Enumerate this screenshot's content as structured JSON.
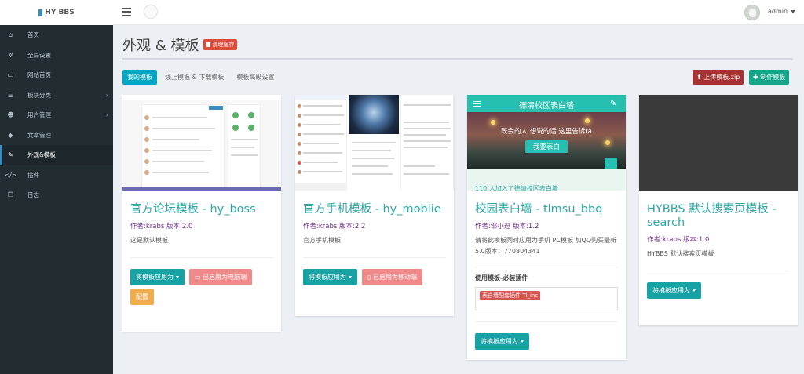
{
  "brand": {
    "name": "HY BBS"
  },
  "header": {
    "user_name": "admin"
  },
  "sidebar": {
    "items": [
      {
        "label": "首页",
        "icon": "home-icon",
        "glyph": "⌂",
        "has_children": false
      },
      {
        "label": "全局设置",
        "icon": "gear-icon",
        "glyph": "✲",
        "has_children": false
      },
      {
        "label": "网站首页",
        "icon": "monitor-icon",
        "glyph": "▭",
        "has_children": false
      },
      {
        "label": "板块分类",
        "icon": "list-icon",
        "glyph": "☰",
        "has_children": true
      },
      {
        "label": "用户管理",
        "icon": "users-icon",
        "glyph": "☻",
        "has_children": true
      },
      {
        "label": "文章管理",
        "icon": "tag-icon",
        "glyph": "◆",
        "has_children": false
      },
      {
        "label": "外观&模板",
        "icon": "brush-icon",
        "glyph": "✎",
        "has_children": false,
        "active": true
      },
      {
        "label": "插件",
        "icon": "code-icon",
        "glyph": "</>",
        "has_children": false
      },
      {
        "label": "日志",
        "icon": "cube-icon",
        "glyph": "❒",
        "has_children": false
      }
    ]
  },
  "page": {
    "title": "外观 & 模板",
    "clear_cache_label": "清理缓存"
  },
  "tabs": [
    {
      "label": "我的模板",
      "active": true
    },
    {
      "label": "线上模板 & 下载模板",
      "active": false
    },
    {
      "label": "模板高级设置",
      "active": false
    }
  ],
  "actions": {
    "upload_label": "上传模板.zip",
    "make_label": "制作模板"
  },
  "cards": [
    {
      "title": "官方论坛模板 - hy_boss",
      "author": "作者:krabs 版本:2.0",
      "description": "这是默认模板",
      "apply_label": "将模板应用为",
      "enabled_label": "已启用为电脑端",
      "config_label": "配置"
    },
    {
      "title": "官方手机模板 - hy_moblie",
      "author": "作者:krabs 版本:2.2",
      "description": "官方手机模板",
      "apply_label": "将模板应用为",
      "enabled_label": "已启用为移动端"
    },
    {
      "title": "校园表白墙 - tlmsu_bbq",
      "author": "作者:邹小逗 版本:1.2",
      "description": "请将此模板同时应用为手机 PC模板 加QQ购买最新5.0版本：770804341",
      "plugins_heading": "使用模板-必装插件",
      "plugin_tag": "表白墙配套插件 Tl_inc",
      "apply_label": "将模板应用为",
      "preview": {
        "header_title": "德清校区表白墙",
        "tagline": "既会的人 想说的话 这里告诉ta",
        "cta": "我要表白",
        "footer": "110 人加入了德清校区表白墙"
      }
    },
    {
      "title": "HYBBS 默认搜索页模板 - search",
      "author": "作者:krabs 版本:1.0",
      "description": "HYBBS 默认搜索页模板",
      "apply_label": "将模板应用为"
    }
  ],
  "colors": {
    "sidebar_bg": "#222d32",
    "accent_teal": "#17a2a4",
    "danger": "#dd4b39",
    "author_purple": "#6f2c85"
  }
}
